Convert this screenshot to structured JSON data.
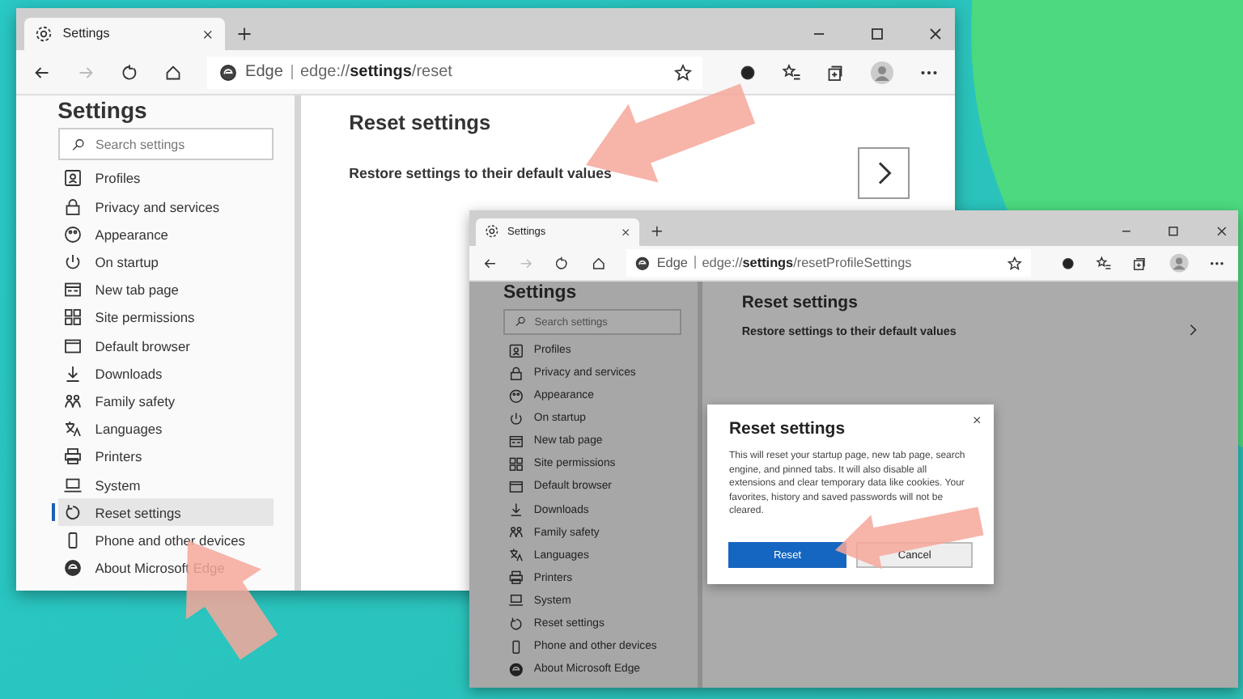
{
  "windows": [
    {
      "tab": {
        "title": "Settings"
      },
      "address": {
        "brand": "Edge",
        "url": "edge://**settings**/reset"
      },
      "dimmed": false,
      "sidebar": {
        "heading": "Settings",
        "search": {
          "placeholder": "Search settings"
        },
        "items": [
          {
            "label": "Profiles",
            "selected": false
          },
          {
            "label": "Privacy and services",
            "selected": false
          },
          {
            "label": "Appearance",
            "selected": false
          },
          {
            "label": "On startup",
            "selected": false
          },
          {
            "label": "New tab page",
            "selected": false
          },
          {
            "label": "Site permissions",
            "selected": false
          },
          {
            "label": "Default browser",
            "selected": false
          },
          {
            "label": "Downloads",
            "selected": false
          },
          {
            "label": "Family safety",
            "selected": false
          },
          {
            "label": "Languages",
            "selected": false
          },
          {
            "label": "Printers",
            "selected": false
          },
          {
            "label": "System",
            "selected": false
          },
          {
            "label": "Reset settings",
            "selected": true
          },
          {
            "label": "Phone and other devices",
            "selected": false
          },
          {
            "label": "About Microsoft Edge",
            "selected": false
          }
        ]
      },
      "content": {
        "heading": "Reset settings",
        "row": {
          "label": "Restore settings to their default values",
          "kind": "boxed"
        }
      }
    },
    {
      "tab": {
        "title": "Settings"
      },
      "address": {
        "brand": "Edge",
        "url": "edge://**settings**/resetProfileSettings"
      },
      "dimmed": true,
      "sidebar": {
        "heading": "Settings",
        "search": {
          "placeholder": "Search settings"
        },
        "items": [
          {
            "label": "Profiles",
            "selected": false
          },
          {
            "label": "Privacy and services",
            "selected": false
          },
          {
            "label": "Appearance",
            "selected": false
          },
          {
            "label": "On startup",
            "selected": false
          },
          {
            "label": "New tab page",
            "selected": false
          },
          {
            "label": "Site permissions",
            "selected": false
          },
          {
            "label": "Default browser",
            "selected": false
          },
          {
            "label": "Downloads",
            "selected": false
          },
          {
            "label": "Family safety",
            "selected": false
          },
          {
            "label": "Languages",
            "selected": false
          },
          {
            "label": "Printers",
            "selected": false
          },
          {
            "label": "System",
            "selected": false
          },
          {
            "label": "Reset settings",
            "selected": false
          },
          {
            "label": "Phone and other devices",
            "selected": false
          },
          {
            "label": "About Microsoft Edge",
            "selected": false
          }
        ]
      },
      "content": {
        "heading": "Reset settings",
        "row": {
          "label": "Restore settings to their default values",
          "kind": "plain"
        }
      },
      "dialog": {
        "title": "Reset settings",
        "body": "This will reset your startup page, new tab page, search engine, and pinned tabs. It will also disable all extensions and clear temporary data like cookies. Your favorites, history and saved passwords will not be cleared.",
        "buttons": [
          {
            "label": "Reset",
            "kind": "primary"
          },
          {
            "label": "Cancel",
            "kind": "secondary"
          }
        ]
      }
    }
  ]
}
